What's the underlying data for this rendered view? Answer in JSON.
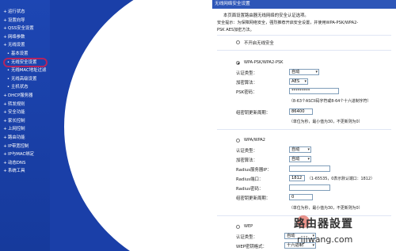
{
  "sidebar": {
    "items": [
      {
        "label": "运行状态",
        "sub": false,
        "active": false
      },
      {
        "label": "设置向导",
        "sub": false,
        "active": false
      },
      {
        "label": "QSS安全设置",
        "sub": false,
        "active": false
      },
      {
        "label": "网络参数",
        "sub": false,
        "active": false
      },
      {
        "label": "无线设置",
        "sub": false,
        "active": false
      },
      {
        "label": "基本设置",
        "sub": true,
        "active": false
      },
      {
        "label": "无线安全设置",
        "sub": true,
        "active": true
      },
      {
        "label": "无线MAC地址过滤",
        "sub": true,
        "active": false
      },
      {
        "label": "无线高级设置",
        "sub": true,
        "active": false
      },
      {
        "label": "主机状态",
        "sub": true,
        "active": false
      },
      {
        "label": "DHCP服务器",
        "sub": false,
        "active": false
      },
      {
        "label": "转发规则",
        "sub": false,
        "active": false
      },
      {
        "label": "安全功能",
        "sub": false,
        "active": false
      },
      {
        "label": "家长控制",
        "sub": false,
        "active": false
      },
      {
        "label": "上网控制",
        "sub": false,
        "active": false
      },
      {
        "label": "路由功能",
        "sub": false,
        "active": false
      },
      {
        "label": "IP带宽控制",
        "sub": false,
        "active": false
      },
      {
        "label": "IP与MAC绑定",
        "sub": false,
        "active": false
      },
      {
        "label": "动态DNS",
        "sub": false,
        "active": false
      },
      {
        "label": "系统工具",
        "sub": false,
        "active": false
      }
    ]
  },
  "header": {
    "title": "无线网络安全设置"
  },
  "intro": {
    "line1": "本页面设置路由器无线网络的安全认证选项。",
    "line2": "安全提示：为保障网络安全，强烈推荐开启安全设置，并使用WPA-PSK/WPA2-",
    "line3": "PSK AES加密方法。"
  },
  "no_security": {
    "label": "不开启无线安全"
  },
  "wpa_psk": {
    "label": "WPA-PSK/WPA2-PSK",
    "auth_label": "认证类型：",
    "auth_value": "自动",
    "enc_label": "加密算法：",
    "enc_value": "AES",
    "psk_label": "PSK密码：",
    "psk_value": "*********",
    "psk_hint": "（8-63个ASCII码字符或8-64个十六进制字符）",
    "renew_label": "组密钥更新周期：",
    "renew_value": "86400",
    "renew_hint": "（单位为秒，最小值为30，不更新则为0）"
  },
  "wpa": {
    "label": "WPA/WPA2",
    "auth_label": "认证类型：",
    "auth_value": "自动",
    "enc_label": "加密算法：",
    "enc_value": "自动",
    "radius_ip_label": "Radius服务器IP：",
    "radius_ip_value": "",
    "radius_port_label": "Radius端口：",
    "radius_port_value": "1812",
    "radius_port_hint": "（1-65535，0表示默认端口：1812）",
    "radius_pwd_label": "Radius密码：",
    "radius_pwd_value": "",
    "renew_label": "组密钥更新周期：",
    "renew_value": "0",
    "renew_hint": "（单位为秒，最小值为30，不更新则为0）"
  },
  "wep": {
    "label": "WEP",
    "auth_label": "认证类型：",
    "auth_value": "自动",
    "format_label": "WEP密钥格式：",
    "format_value": "十六进制"
  },
  "watermark": {
    "title": "路由器設置",
    "url": "rijiwang.com"
  }
}
